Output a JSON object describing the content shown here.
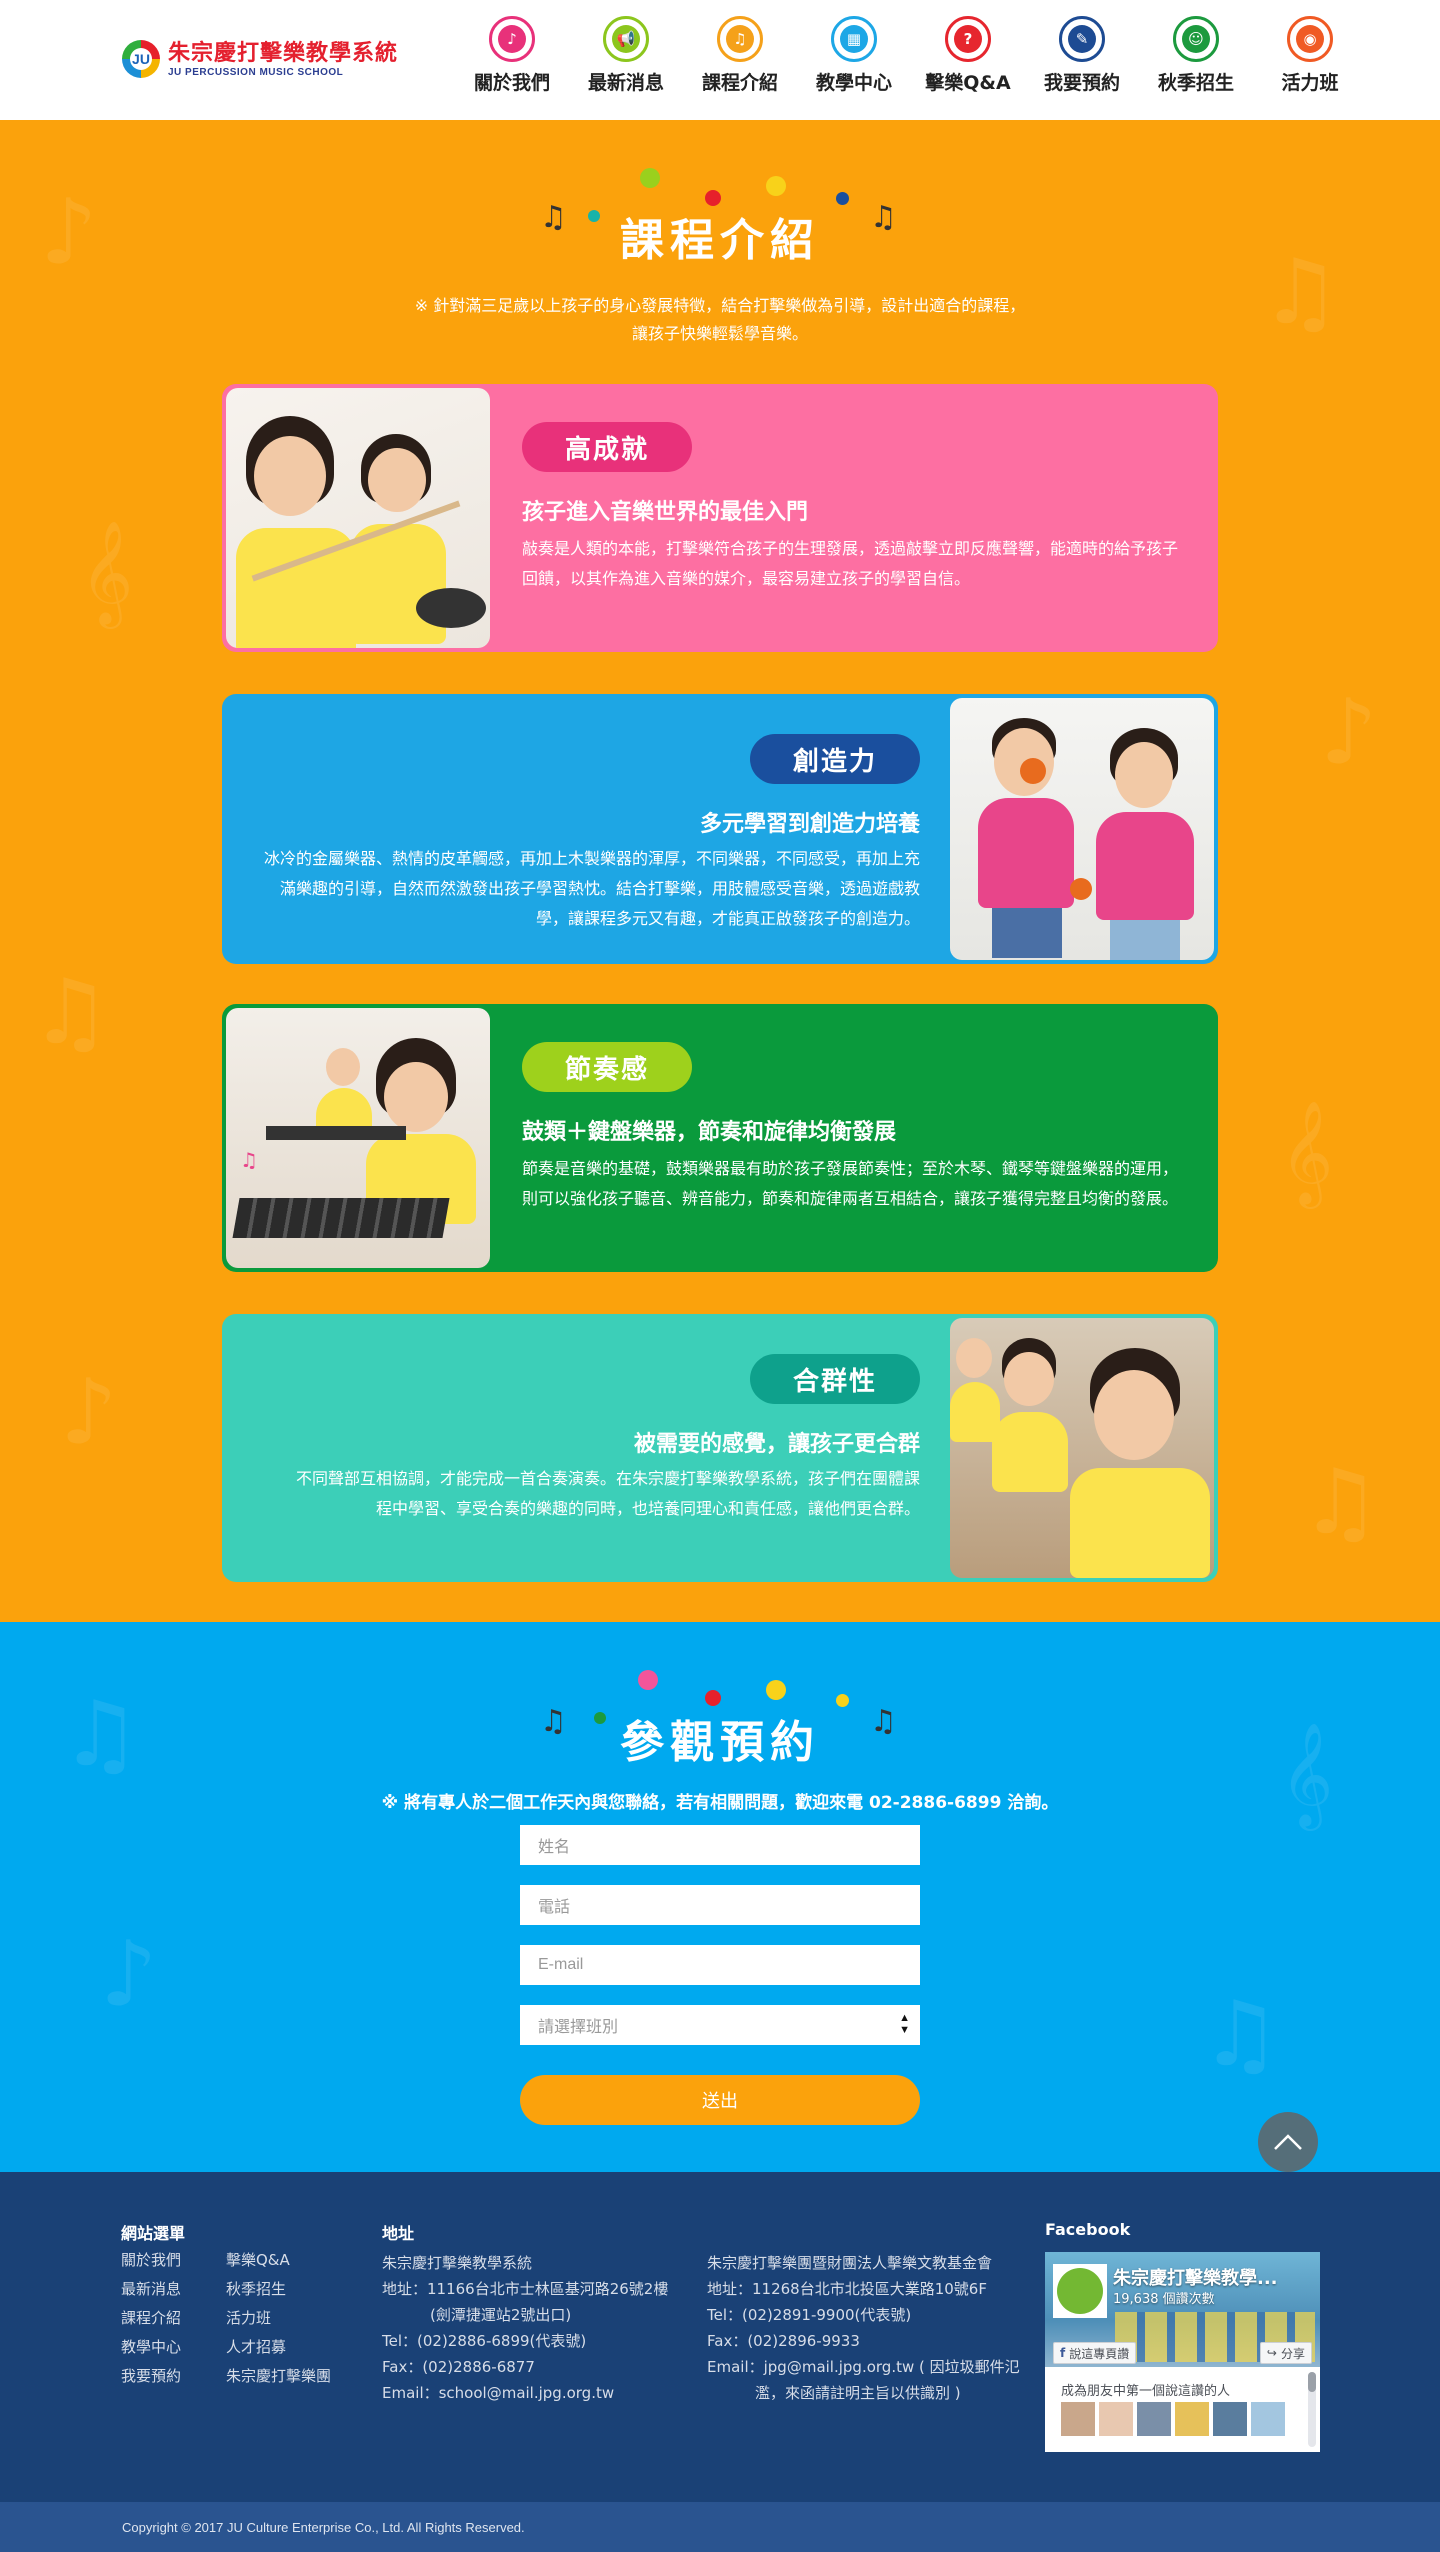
{
  "header": {
    "logo": {
      "zh": "朱宗慶打擊樂教學系統",
      "en": "JU PERCUSSION MUSIC SCHOOL",
      "mark": "JU"
    },
    "nav": [
      {
        "label": "關於我們",
        "icon": "music-note-icon",
        "color": "#e8317a",
        "glyph": "♪"
      },
      {
        "label": "最新消息",
        "icon": "megaphone-icon",
        "color": "#8cc61d",
        "glyph": "📢"
      },
      {
        "label": "課程介紹",
        "icon": "guitar-icon",
        "color": "#f5a11a",
        "glyph": "♫"
      },
      {
        "label": "教學中心",
        "icon": "building-icon",
        "color": "#1da7e6",
        "glyph": "▦"
      },
      {
        "label": "擊樂Q&A",
        "icon": "chat-icon",
        "color": "#e6262e",
        "glyph": "?"
      },
      {
        "label": "我要預約",
        "icon": "document-icon",
        "color": "#1d4b93",
        "glyph": "✎"
      },
      {
        "label": "秋季招生",
        "icon": "person-icon",
        "color": "#1c9a3e",
        "glyph": "☺"
      },
      {
        "label": "活力班",
        "icon": "drum-icon",
        "color": "#f05a24",
        "glyph": "◉"
      }
    ]
  },
  "courses": {
    "title": "課程介紹",
    "desc_line1": "※ 針對滿三足歲以上孩子的身心發展特徵，結合打擊樂做為引導，設計出適合的課程，",
    "desc_line2": "讓孩子快樂輕鬆學音樂。",
    "items": [
      {
        "tag": "高成就",
        "subtitle": "孩子進入音樂世界的最佳入門",
        "body": "敲奏是人類的本能，打擊樂符合孩子的生理發展，透過敲擊立即反應聲響，能適時的給予孩子回饋，以其作為進入音樂的媒介，最容易建立孩子的學習自信。",
        "bg": "#fd6fa2",
        "tag_color": "#e8317a"
      },
      {
        "tag": "創造力",
        "subtitle": "多元學習到創造力培養",
        "body": "冰冷的金屬樂器、熱情的皮革觸感，再加上木製樂器的渾厚，不同樂器，不同感受，再加上充滿樂趣的引導，自然而然激發出孩子學習熱忱。結合打擊樂，用肢體感受音樂，透過遊戲教學，讓課程多元又有趣，才能真正啟發孩子的創造力。",
        "bg": "#1ea6e4",
        "tag_color": "#1a4f9e"
      },
      {
        "tag": "節奏感",
        "subtitle": "鼓類＋鍵盤樂器，節奏和旋律均衡發展",
        "body": "節奏是音樂的基礎，鼓類樂器最有助於孩子發展節奏性；至於木琴、鐵琴等鍵盤樂器的運用，則可以強化孩子聽音、辨音能力，節奏和旋律兩者互相結合，讓孩子獲得完整且均衡的發展。",
        "bg": "#0a9a3c",
        "tag_color": "#9ed11c"
      },
      {
        "tag": "合群性",
        "subtitle": "被需要的感覺，讓孩子更合群",
        "body": "不同聲部互相協調，才能完成一首合奏演奏。在朱宗慶打擊樂教學系統，孩子們在團體課程中學習、享受合奏的樂趣的同時，也培養同理心和責任感，讓他們更合群。",
        "bg": "#3ccfb8",
        "tag_color": "#0ea18c"
      }
    ]
  },
  "booking": {
    "title": "參觀預約",
    "desc": "※ 將有專人於二個工作天內與您聯絡，若有相關問題，歡迎來電 02-2886-6899 洽詢。",
    "fields": {
      "name": "姓名",
      "phone": "電話",
      "email": "E-mail",
      "class": "請選擇班別"
    },
    "submit": "送出"
  },
  "footer": {
    "sitemap_title": "網站選單",
    "sitemap_col1": [
      "關於我們",
      "最新消息",
      "課程介紹",
      "教學中心",
      "我要預約"
    ],
    "sitemap_col2": [
      "擊樂Q&A",
      "秋季招生",
      "活力班",
      "人才招募",
      "朱宗慶打擊樂團"
    ],
    "address_title": "地址",
    "addr1": {
      "name": "朱宗慶打擊樂教學系統",
      "line1": "地址：11166台北市士林區基河路26號2樓",
      "line2": "(劍潭捷運站2號出口)",
      "tel": "Tel：(02)2886-6899(代表號)",
      "fax": "Fax：(02)2886-6877",
      "email": "Email：school@mail.jpg.org.tw"
    },
    "addr2": {
      "name": "朱宗慶打擊樂團暨財團法人擊樂文教基金會",
      "line1": "地址：11268台北市北投區大業路10號6F",
      "tel": "Tel：(02)2891-9900(代表號)",
      "fax": "Fax：(02)2896-9933",
      "email": "Email：jpg@mail.jpg.org.tw ( 因垃圾郵件氾",
      "email2": "濫，來函請註明主旨以供識別 )"
    },
    "facebook_title": "Facebook",
    "fb": {
      "name": "朱宗慶打擊樂教學...",
      "likes": "19,638 個讚次數",
      "like_btn": "說這專頁讚",
      "share_btn": "分享",
      "friends": "成為朋友中第一個說這讚的人"
    }
  },
  "copyright": "Copyright © 2017 JU Culture Enterprise Co., Ltd. All Rights Reserved."
}
